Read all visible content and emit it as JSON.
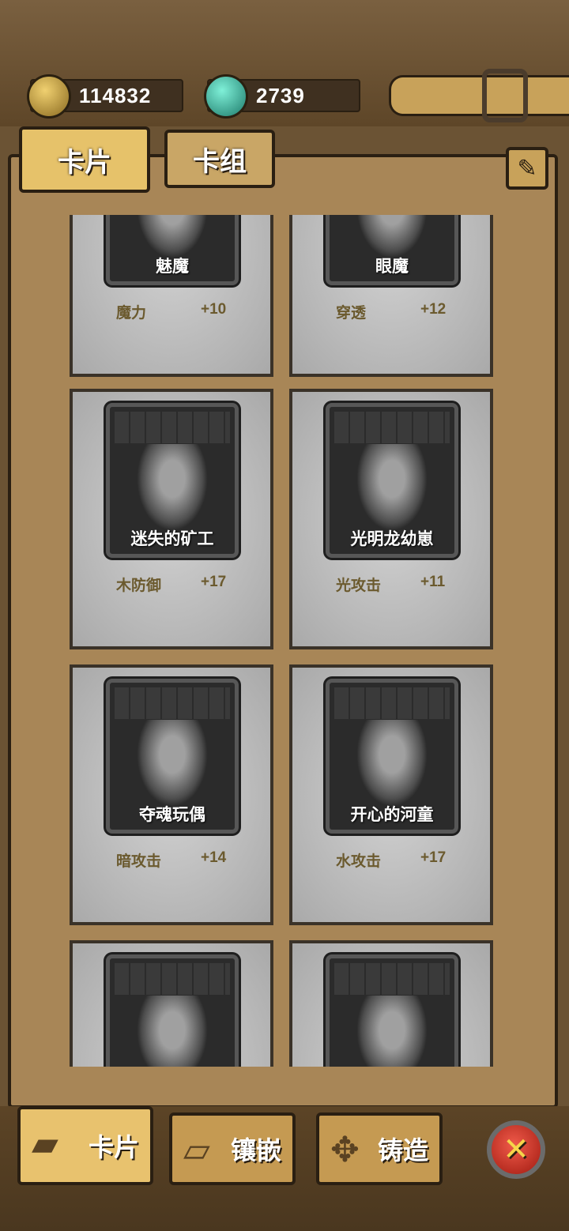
{
  "resources": {
    "gold": "114832",
    "gems": "2739"
  },
  "tabs": [
    {
      "label": "卡片",
      "active": true
    },
    {
      "label": "卡组",
      "active": false
    }
  ],
  "cards": [
    {
      "name": "魅魔",
      "stat": "魔力",
      "value": "+10"
    },
    {
      "name": "眼魔",
      "stat": "穿透",
      "value": "+12"
    },
    {
      "name": "迷失的矿工",
      "stat": "木防御",
      "value": "+17"
    },
    {
      "name": "光明龙幼崽",
      "stat": "光攻击",
      "value": "+11"
    },
    {
      "name": "夺魂玩偶",
      "stat": "暗攻击",
      "value": "+14"
    },
    {
      "name": "开心的河童",
      "stat": "水攻击",
      "value": "+17"
    },
    {
      "name": "",
      "stat": "",
      "value": ""
    },
    {
      "name": "",
      "stat": "",
      "value": ""
    }
  ],
  "bottom_nav": [
    {
      "label": "卡片",
      "icon": "cards-icon",
      "active": true
    },
    {
      "label": "镶嵌",
      "icon": "book-icon",
      "active": false
    },
    {
      "label": "铸造",
      "icon": "forge-icon",
      "active": false
    }
  ],
  "colors": {
    "wood": "#a88657",
    "tab_active": "#e6c26a",
    "close_button": "#d63a2a"
  }
}
